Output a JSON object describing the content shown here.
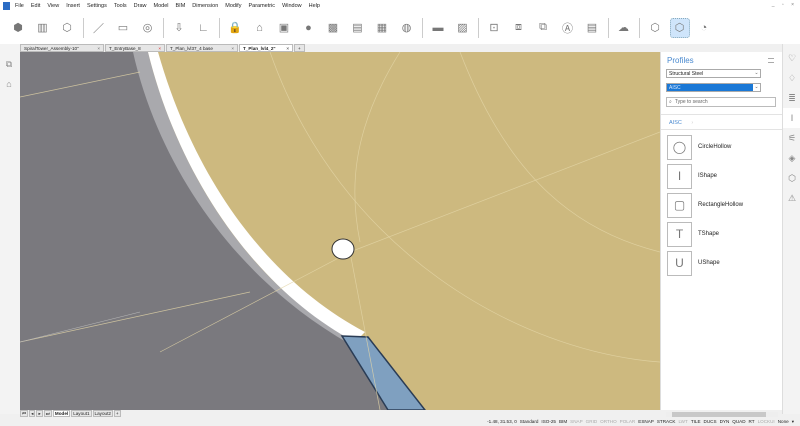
{
  "menu": [
    "File",
    "Edit",
    "View",
    "Insert",
    "Settings",
    "Tools",
    "Draw",
    "Model",
    "BIM",
    "Dimension",
    "Modify",
    "Parametric",
    "Window",
    "Help"
  ],
  "toolbar": {
    "icons": [
      "box-icon",
      "extrude-icon",
      "solid-icon",
      "line-icon",
      "rectangle-icon",
      "circle-icon",
      "push-pull-icon",
      "wall-icon",
      "lock-icon",
      "house-icon",
      "building-icon",
      "globe-icon",
      "block-icon",
      "window-icon",
      "grid-icon",
      "slab-icon",
      "profile-icon",
      "landscape-icon",
      "section-icon",
      "view-icon",
      "transform-icon",
      "label-icon",
      "table-icon",
      "cloud-icon",
      "cube-icon",
      "cube-active-icon",
      "curve-icon"
    ]
  },
  "doc_tabs": [
    {
      "label": "SpiralTower_Assembly-10\""
    },
    {
      "label": "T_EntryBase_8"
    },
    {
      "label": "T_Plan_lvl37_4 base"
    },
    {
      "label": "T_Plan_lvl4_2\"",
      "active": true
    }
  ],
  "panel": {
    "title": "Profiles",
    "library": "Structural Steel",
    "standard": "AISC",
    "search_placeholder": "Type to search",
    "breadcrumb": "AISC",
    "items": [
      {
        "label": "CircleHollow",
        "icon": "◯"
      },
      {
        "label": "IShape",
        "icon": "I"
      },
      {
        "label": "RectangleHollow",
        "icon": "▢"
      },
      {
        "label": "TShape",
        "icon": "T"
      },
      {
        "label": "UShape",
        "icon": "U"
      }
    ]
  },
  "layout_tabs": [
    "Model",
    "Layout1",
    "Layout2"
  ],
  "status": {
    "coords": "-1.48, 31.53, 0",
    "items": [
      {
        "t": "Standard",
        "on": true
      },
      {
        "t": "ISO-25",
        "on": true
      },
      {
        "t": "BIM",
        "on": true
      },
      {
        "t": "SNAP",
        "on": false
      },
      {
        "t": "GRID",
        "on": false
      },
      {
        "t": "ORTHO",
        "on": false
      },
      {
        "t": "POLAR",
        "on": false
      },
      {
        "t": "ESNAP",
        "on": true
      },
      {
        "t": "STRACK",
        "on": true
      },
      {
        "t": "LWT",
        "on": false
      },
      {
        "t": "TILE",
        "on": true
      },
      {
        "t": "DUCS",
        "on": true
      },
      {
        "t": "DYN",
        "on": true
      },
      {
        "t": "QUAD",
        "on": true
      },
      {
        "t": "RT",
        "on": true
      },
      {
        "t": "LOCKUI",
        "on": false
      },
      {
        "t": "None",
        "on": true
      }
    ]
  }
}
